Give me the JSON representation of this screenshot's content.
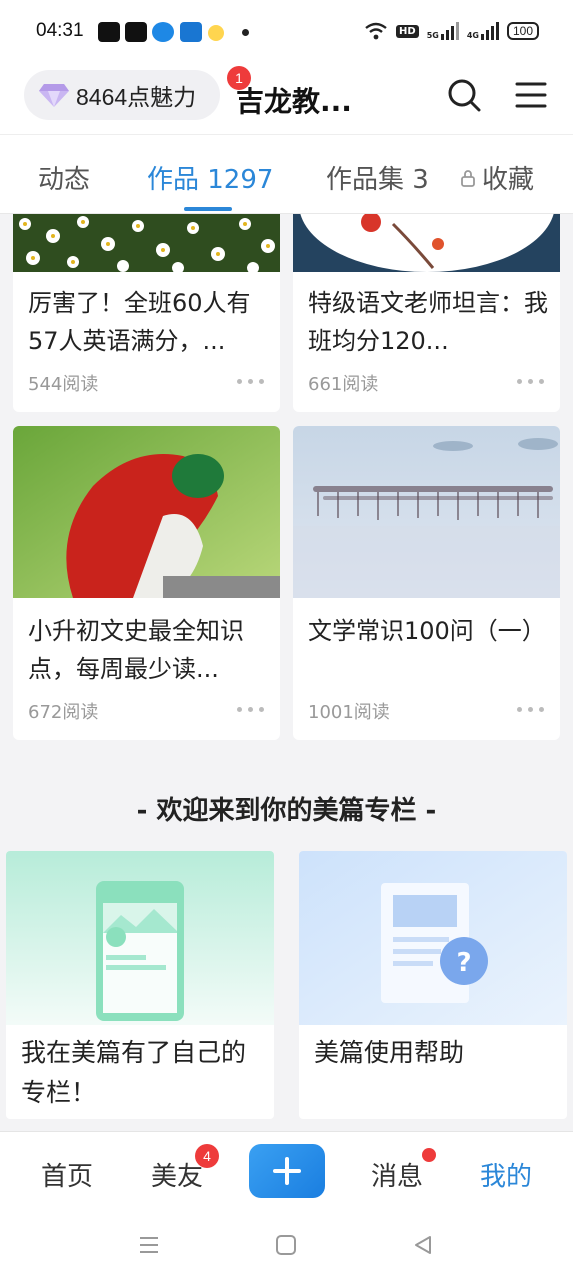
{
  "status_bar": {
    "time": "04:31",
    "network_5g": "5G",
    "network_4g": "4G",
    "hd": "HD",
    "battery": "100"
  },
  "header": {
    "charm_label": "8464点魅力",
    "charm_badge": "1",
    "title": "吉龙教...",
    "icons": [
      "diamond-icon",
      "search-icon",
      "menu-icon"
    ]
  },
  "tabs": [
    {
      "label": "动态"
    },
    {
      "label": "作品 1297",
      "active": true
    },
    {
      "label": "作品集 3"
    },
    {
      "label": "收藏",
      "icon": "lock-icon"
    }
  ],
  "cards": [
    {
      "title": "厉害了！全班60人有57人英语满分，...",
      "reads": "544阅读",
      "image": "daisy-field"
    },
    {
      "title": "特级语文老师坦言：我班均分120...",
      "reads": "661阅读",
      "image": "ink-painting-plate"
    },
    {
      "title": "小升初文史最全知识点，每周最少读...",
      "reads": "672阅读",
      "image": "red-bird"
    },
    {
      "title": "文学常识100问（一）",
      "reads": "1001阅读",
      "image": "flamingos-lake"
    }
  ],
  "section": {
    "title": "- 欢迎来到你的美篇专栏 -"
  },
  "promos": [
    {
      "text": "我在美篇有了自己的专栏！",
      "image": "phone-column-illustration"
    },
    {
      "text": "美篇使用帮助",
      "image": "help-document-illustration"
    }
  ],
  "bottom_nav": {
    "items": [
      {
        "label": "首页"
      },
      {
        "label": "美友",
        "badge": "4"
      },
      {
        "label": "消息",
        "dot": true
      },
      {
        "label": "我的",
        "active": true
      }
    ],
    "plus": "plus-icon"
  },
  "colors": {
    "accent": "#2b87d8",
    "badge": "#ee3b3b"
  }
}
